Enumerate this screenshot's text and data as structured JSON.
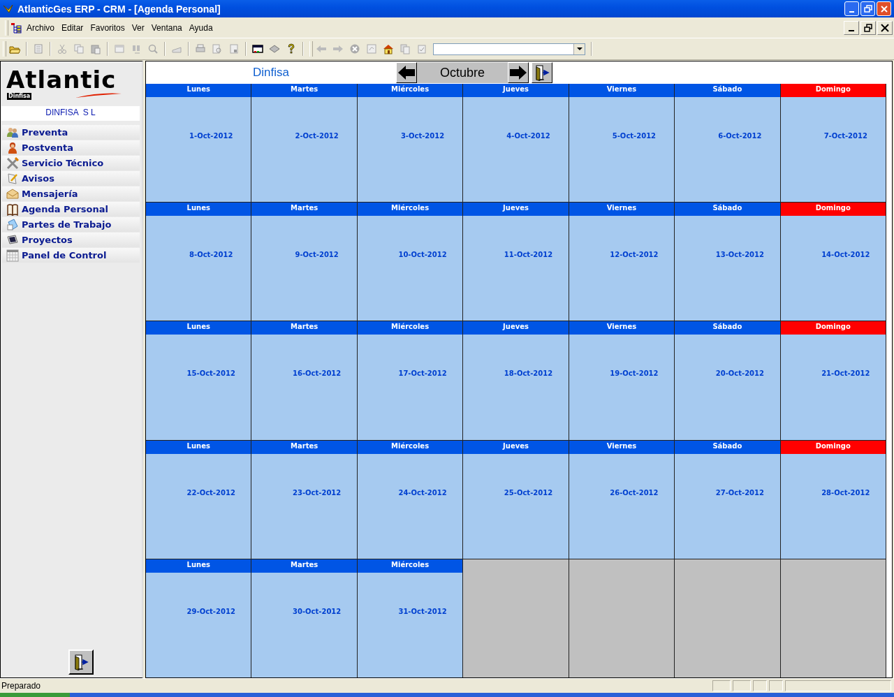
{
  "window": {
    "title": "AtlanticGes ERP - CRM - [Agenda Personal]"
  },
  "menu": [
    "Archivo",
    "Editar",
    "Favoritos",
    "Ver",
    "Ventana",
    "Ayuda"
  ],
  "sidebar": {
    "logo": "Atlantic",
    "logo_sub": "Dinfisa",
    "company": "DINFISA  S L",
    "items": [
      {
        "label": "Preventa",
        "kind": "people"
      },
      {
        "label": "Postventa",
        "kind": "person"
      },
      {
        "label": "Servicio Técnico",
        "kind": "tools"
      },
      {
        "label": "Avisos",
        "kind": "note"
      },
      {
        "label": "Mensajería",
        "kind": "mail"
      },
      {
        "label": "Agenda Personal",
        "kind": "book"
      },
      {
        "label": "Partes de Trabajo",
        "kind": "doc"
      },
      {
        "label": "Proyectos",
        "kind": "monitor"
      },
      {
        "label": "Panel de Control",
        "kind": "grid"
      }
    ]
  },
  "calendar": {
    "company": "Dinfisa",
    "month": "Octubre",
    "cells": [
      {
        "kind": "day",
        "weekday": "Lunes",
        "date": "1-Oct-2012",
        "color": "#0055e5"
      },
      {
        "kind": "day",
        "weekday": "Martes",
        "date": "2-Oct-2012",
        "color": "#0055e5"
      },
      {
        "kind": "day",
        "weekday": "Miércoles",
        "date": "3-Oct-2012",
        "color": "#0055e5"
      },
      {
        "kind": "day",
        "weekday": "Jueves",
        "date": "4-Oct-2012",
        "color": "#0055e5"
      },
      {
        "kind": "day",
        "weekday": "Viernes",
        "date": "5-Oct-2012",
        "color": "#0055e5"
      },
      {
        "kind": "day",
        "weekday": "Sábado",
        "date": "6-Oct-2012",
        "color": "#0055e5"
      },
      {
        "kind": "day",
        "weekday": "Domingo",
        "date": "7-Oct-2012",
        "color": "#ff0000"
      },
      {
        "kind": "day",
        "weekday": "Lunes",
        "date": "8-Oct-2012",
        "color": "#0055e5"
      },
      {
        "kind": "day",
        "weekday": "Martes",
        "date": "9-Oct-2012",
        "color": "#0055e5"
      },
      {
        "kind": "day",
        "weekday": "Miércoles",
        "date": "10-Oct-2012",
        "color": "#0055e5"
      },
      {
        "kind": "day",
        "weekday": "Jueves",
        "date": "11-Oct-2012",
        "color": "#0055e5"
      },
      {
        "kind": "day",
        "weekday": "Viernes",
        "date": "12-Oct-2012",
        "color": "#0055e5"
      },
      {
        "kind": "day",
        "weekday": "Sábado",
        "date": "13-Oct-2012",
        "color": "#0055e5"
      },
      {
        "kind": "day",
        "weekday": "Domingo",
        "date": "14-Oct-2012",
        "color": "#ff0000"
      },
      {
        "kind": "day",
        "weekday": "Lunes",
        "date": "15-Oct-2012",
        "color": "#0055e5"
      },
      {
        "kind": "day",
        "weekday": "Martes",
        "date": "16-Oct-2012",
        "color": "#0055e5"
      },
      {
        "kind": "day",
        "weekday": "Miércoles",
        "date": "17-Oct-2012",
        "color": "#0055e5"
      },
      {
        "kind": "day",
        "weekday": "Jueves",
        "date": "18-Oct-2012",
        "color": "#0055e5"
      },
      {
        "kind": "day",
        "weekday": "Viernes",
        "date": "19-Oct-2012",
        "color": "#0055e5"
      },
      {
        "kind": "day",
        "weekday": "Sábado",
        "date": "20-Oct-2012",
        "color": "#0055e5"
      },
      {
        "kind": "day",
        "weekday": "Domingo",
        "date": "21-Oct-2012",
        "color": "#ff0000"
      },
      {
        "kind": "day",
        "weekday": "Lunes",
        "date": "22-Oct-2012",
        "color": "#0055e5"
      },
      {
        "kind": "day",
        "weekday": "Martes",
        "date": "23-Oct-2012",
        "color": "#0055e5"
      },
      {
        "kind": "day",
        "weekday": "Miércoles",
        "date": "24-Oct-2012",
        "color": "#0055e5"
      },
      {
        "kind": "day",
        "weekday": "Jueves",
        "date": "25-Oct-2012",
        "color": "#0055e5"
      },
      {
        "kind": "day",
        "weekday": "Viernes",
        "date": "26-Oct-2012",
        "color": "#0055e5"
      },
      {
        "kind": "day",
        "weekday": "Sábado",
        "date": "27-Oct-2012",
        "color": "#0055e5"
      },
      {
        "kind": "day",
        "weekday": "Domingo",
        "date": "28-Oct-2012",
        "color": "#ff0000"
      },
      {
        "kind": "day",
        "weekday": "Lunes",
        "date": "29-Oct-2012",
        "color": "#0055e5"
      },
      {
        "kind": "day",
        "weekday": "Martes",
        "date": "30-Oct-2012",
        "color": "#0055e5"
      },
      {
        "kind": "day",
        "weekday": "Miércoles",
        "date": "31-Oct-2012",
        "color": "#0055e5"
      },
      {
        "kind": "empty"
      },
      {
        "kind": "empty"
      },
      {
        "kind": "empty"
      },
      {
        "kind": "empty"
      }
    ]
  },
  "status_bar": {
    "text": "Preparado"
  }
}
